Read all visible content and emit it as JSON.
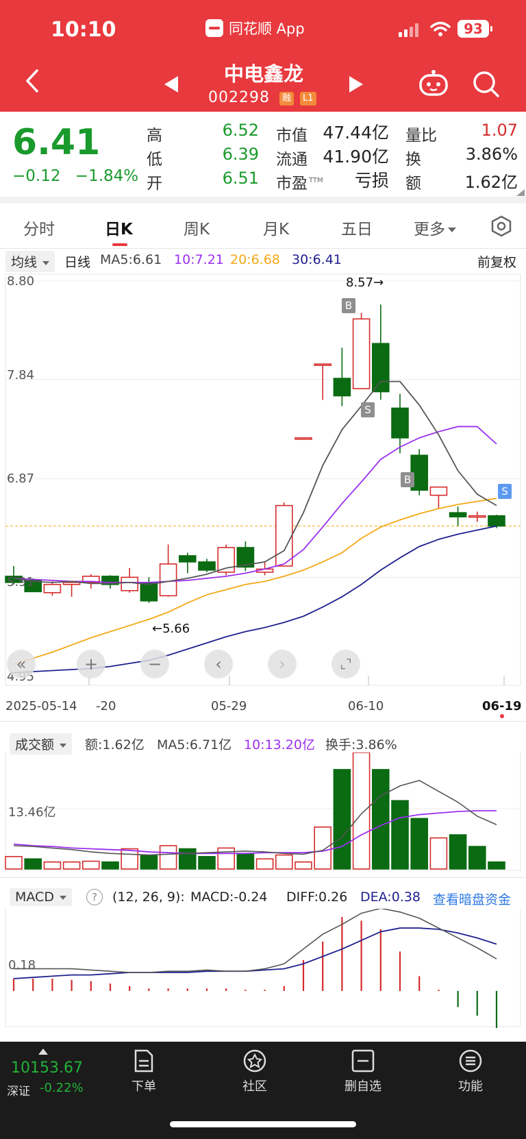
{
  "status_bar": {
    "time": "10:10",
    "app_name": "同花顺 App",
    "battery": "93"
  },
  "header": {
    "stock_name": "中电鑫龙",
    "stock_code": "002298",
    "tag_margin": "融",
    "tag_level": "L1"
  },
  "quote": {
    "price": "6.41",
    "change": "−0.12",
    "change_pct": "−1.84%",
    "high_label": "高",
    "high": "6.52",
    "low_label": "低",
    "low": "6.39",
    "open_label": "开",
    "open": "6.51",
    "mktcap_label": "市值",
    "mktcap": "47.44亿",
    "float_label": "流通",
    "float": "41.90亿",
    "pe_label": "市盈",
    "pe_sup": "TTM",
    "pe": "亏损",
    "vol_ratio_label": "量比",
    "vol_ratio": "1.07",
    "turnover_label": "换",
    "turnover": "3.86%",
    "amount_label": "额",
    "amount": "1.62亿"
  },
  "tabs": [
    "分时",
    "日K",
    "周K",
    "月K",
    "五日",
    "更多"
  ],
  "active_tab": "日K",
  "kline_legend": {
    "selector": "均线",
    "period": "日线",
    "ma5": "MA5:6.61",
    "ma10": "10:7.21",
    "ma20": "20:6.68",
    "ma30": "30:6.41",
    "adjust": "前复权"
  },
  "price_axis": [
    "8.80",
    "7.84",
    "6.87",
    "5.91",
    "4.95"
  ],
  "date_axis": [
    "2025-05-14",
    "-20",
    "05-29",
    "06-10",
    "06-19"
  ],
  "annotations": {
    "high_mark": "8.57→",
    "low_mark": "←5.66",
    "buy": "B",
    "sell": "S"
  },
  "volume_legend": {
    "selector": "成交额",
    "amount": "额:1.62亿",
    "ma5": "MA5:6.71亿",
    "ma10": "10:13.20亿",
    "turnover": "换手:3.86%",
    "axis_label": "13.46亿"
  },
  "macd_legend": {
    "selector": "MACD",
    "help": "?",
    "params": "(12, 26, 9):",
    "macd": "MACD:-0.24",
    "diff": "DIFF:0.26",
    "dea": "DEA:0.38",
    "link": "查看暗盘资金",
    "axis_label": "0.18"
  },
  "bottom_bar": {
    "index_value": "10153.67",
    "index_name": "深证",
    "index_change": "-0.22%",
    "nav": [
      "下单",
      "社区",
      "删自选",
      "功能"
    ]
  },
  "colors": {
    "header_red": "#e8393e",
    "up_red": "#d62b2b",
    "down_green": "#0a6b12",
    "ma5": "#555555",
    "ma10": "#9b2ff0",
    "ma20": "#f4a817",
    "ma30": "#1f1f8f"
  },
  "chart_data": [
    {
      "type": "candlestick",
      "title": "",
      "ylim": [
        4.95,
        8.8
      ],
      "candles": [
        {
          "o": 5.92,
          "h": 6.02,
          "l": 5.84,
          "c": 5.86
        },
        {
          "o": 5.88,
          "h": 5.9,
          "l": 5.78,
          "c": 5.77
        },
        {
          "o": 5.76,
          "h": 5.87,
          "l": 5.73,
          "c": 5.84
        },
        {
          "o": 5.84,
          "h": 5.87,
          "l": 5.72,
          "c": 5.86
        },
        {
          "o": 5.86,
          "h": 5.94,
          "l": 5.8,
          "c": 5.92
        },
        {
          "o": 5.92,
          "h": 5.93,
          "l": 5.8,
          "c": 5.84
        },
        {
          "o": 5.78,
          "h": 6.0,
          "l": 5.76,
          "c": 5.91
        },
        {
          "o": 5.86,
          "h": 5.91,
          "l": 5.66,
          "c": 5.68
        },
        {
          "o": 5.73,
          "h": 6.23,
          "l": 5.72,
          "c": 6.04
        },
        {
          "o": 6.12,
          "h": 6.15,
          "l": 5.95,
          "c": 6.06
        },
        {
          "o": 6.06,
          "h": 6.09,
          "l": 5.96,
          "c": 5.98
        },
        {
          "o": 5.96,
          "h": 6.23,
          "l": 5.93,
          "c": 6.2
        },
        {
          "o": 6.2,
          "h": 6.26,
          "l": 5.97,
          "c": 6.01
        },
        {
          "o": 5.96,
          "h": 6.06,
          "l": 5.93,
          "c": 5.99
        },
        {
          "o": 6.02,
          "h": 6.64,
          "l": 6.02,
          "c": 6.61
        },
        {
          "o": 7.27,
          "h": 7.27,
          "l": 7.27,
          "c": 7.27
        },
        {
          "o": 7.99,
          "h": 7.99,
          "l": 7.64,
          "c": 7.99
        },
        {
          "o": 7.85,
          "h": 8.15,
          "l": 7.58,
          "c": 7.68
        },
        {
          "o": 7.75,
          "h": 8.49,
          "l": 7.75,
          "c": 8.43
        },
        {
          "o": 8.19,
          "h": 8.57,
          "l": 7.64,
          "c": 7.72
        },
        {
          "o": 7.56,
          "h": 7.7,
          "l": 7.12,
          "c": 7.27
        },
        {
          "o": 7.1,
          "h": 7.16,
          "l": 6.71,
          "c": 6.76
        },
        {
          "o": 6.71,
          "h": 6.78,
          "l": 6.58,
          "c": 6.79
        },
        {
          "o": 6.54,
          "h": 6.6,
          "l": 6.41,
          "c": 6.5
        },
        {
          "o": 6.51,
          "h": 6.55,
          "l": 6.45,
          "c": 6.51
        },
        {
          "o": 6.51,
          "h": 6.52,
          "l": 6.39,
          "c": 6.41
        }
      ],
      "ma5": [
        5.9,
        5.87,
        5.86,
        5.87,
        5.85,
        5.85,
        5.86,
        5.84,
        5.87,
        5.9,
        5.94,
        6.0,
        6.03,
        6.06,
        6.17,
        6.54,
        7.0,
        7.35,
        7.58,
        7.82,
        7.82,
        7.59,
        7.3,
        6.95,
        6.72,
        6.61
      ],
      "ma10": [
        5.9,
        5.89,
        5.88,
        5.87,
        5.87,
        5.86,
        5.86,
        5.86,
        5.87,
        5.88,
        5.9,
        5.92,
        5.95,
        5.99,
        6.04,
        6.18,
        6.4,
        6.63,
        6.84,
        7.06,
        7.18,
        7.27,
        7.33,
        7.38,
        7.38,
        7.21
      ],
      "ma20": [
        5.06,
        5.12,
        5.18,
        5.25,
        5.32,
        5.38,
        5.44,
        5.5,
        5.57,
        5.66,
        5.74,
        5.79,
        5.84,
        5.87,
        5.92,
        5.98,
        6.06,
        6.15,
        6.29,
        6.4,
        6.47,
        6.53,
        6.58,
        6.62,
        6.65,
        6.68
      ],
      "ma30": [
        4.98,
        4.99,
        5.0,
        5.01,
        5.02,
        5.04,
        5.07,
        5.1,
        5.15,
        5.21,
        5.27,
        5.33,
        5.38,
        5.42,
        5.47,
        5.53,
        5.62,
        5.72,
        5.84,
        5.98,
        6.1,
        6.21,
        6.28,
        6.33,
        6.37,
        6.41
      ]
    },
    {
      "type": "bar",
      "title": "成交额",
      "values": [
        1.6,
        1.3,
        0.9,
        0.9,
        1.0,
        0.9,
        2.6,
        1.7,
        3.0,
        2.6,
        1.6,
        2.7,
        1.9,
        1.3,
        1.8,
        0.9,
        5.4,
        12.8,
        15.0,
        12.8,
        8.8,
        6.5,
        4.0,
        4.4,
        2.9,
        0.9
      ],
      "up": [
        true,
        false,
        true,
        true,
        true,
        false,
        true,
        false,
        true,
        false,
        false,
        true,
        false,
        true,
        true,
        true,
        true,
        false,
        true,
        false,
        false,
        false,
        true,
        false,
        false,
        false
      ],
      "ma5": [
        3.0,
        2.9,
        2.7,
        2.5,
        2.2,
        2.0,
        1.9,
        1.8,
        1.9,
        2.0,
        2.1,
        2.2,
        2.3,
        2.2,
        2.0,
        1.9,
        2.4,
        4.1,
        7.1,
        9.4,
        10.7,
        11.4,
        10.0,
        8.6,
        6.8,
        5.7
      ],
      "ma10": [
        3.2,
        3.0,
        2.9,
        2.7,
        2.6,
        2.5,
        2.4,
        2.2,
        2.1,
        2.0,
        2.0,
        2.0,
        2.0,
        2.1,
        2.1,
        2.1,
        2.3,
        2.9,
        4.4,
        5.6,
        6.6,
        7.0,
        7.2,
        7.4,
        7.5,
        7.5
      ]
    },
    {
      "type": "bar",
      "title": "MACD",
      "hist": [
        0.1,
        0.1,
        0.1,
        0.09,
        0.08,
        0.06,
        0.04,
        0.02,
        0.02,
        0.02,
        0.02,
        0.02,
        0.01,
        0.01,
        0.04,
        0.25,
        0.4,
        0.6,
        0.57,
        0.5,
        0.32,
        0.12,
        0.01,
        -0.13,
        -0.2,
        -0.3
      ],
      "diff": [
        0.18,
        0.18,
        0.18,
        0.18,
        0.17,
        0.16,
        0.15,
        0.15,
        0.16,
        0.16,
        0.17,
        0.16,
        0.16,
        0.18,
        0.22,
        0.34,
        0.46,
        0.54,
        0.63,
        0.67,
        0.64,
        0.59,
        0.51,
        0.43,
        0.35,
        0.26
      ],
      "dea": [
        0.1,
        0.11,
        0.12,
        0.13,
        0.13,
        0.14,
        0.15,
        0.15,
        0.15,
        0.15,
        0.16,
        0.16,
        0.16,
        0.17,
        0.18,
        0.22,
        0.28,
        0.34,
        0.41,
        0.48,
        0.51,
        0.51,
        0.5,
        0.47,
        0.43,
        0.38
      ]
    }
  ]
}
